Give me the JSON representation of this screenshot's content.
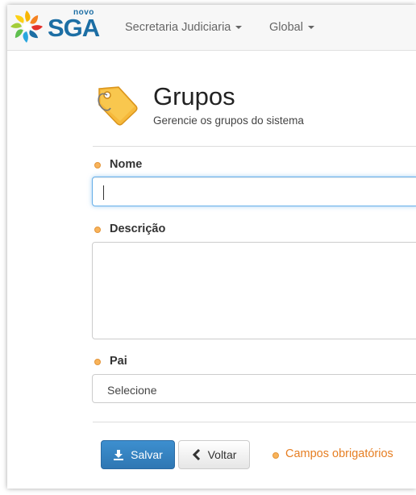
{
  "navbar": {
    "brand_top": "novo",
    "brand_name": "SGA",
    "menus": [
      {
        "label": "Secretaria Judiciaria"
      },
      {
        "label": "Global"
      }
    ]
  },
  "page": {
    "icon": "tag-icon",
    "title": "Grupos",
    "subtitle": "Gerencie os grupos do sistema"
  },
  "form": {
    "nome": {
      "label": "Nome",
      "value": ""
    },
    "descricao": {
      "label": "Descrição",
      "value": ""
    },
    "pai": {
      "label": "Pai",
      "selected": "Selecione"
    }
  },
  "actions": {
    "save_label": "Salvar",
    "back_label": "Voltar",
    "required_note": "Campos obrigatórios"
  },
  "colors": {
    "primary": "#2f77b3",
    "required": "#e67e22",
    "brand": "#1c6ea4"
  }
}
